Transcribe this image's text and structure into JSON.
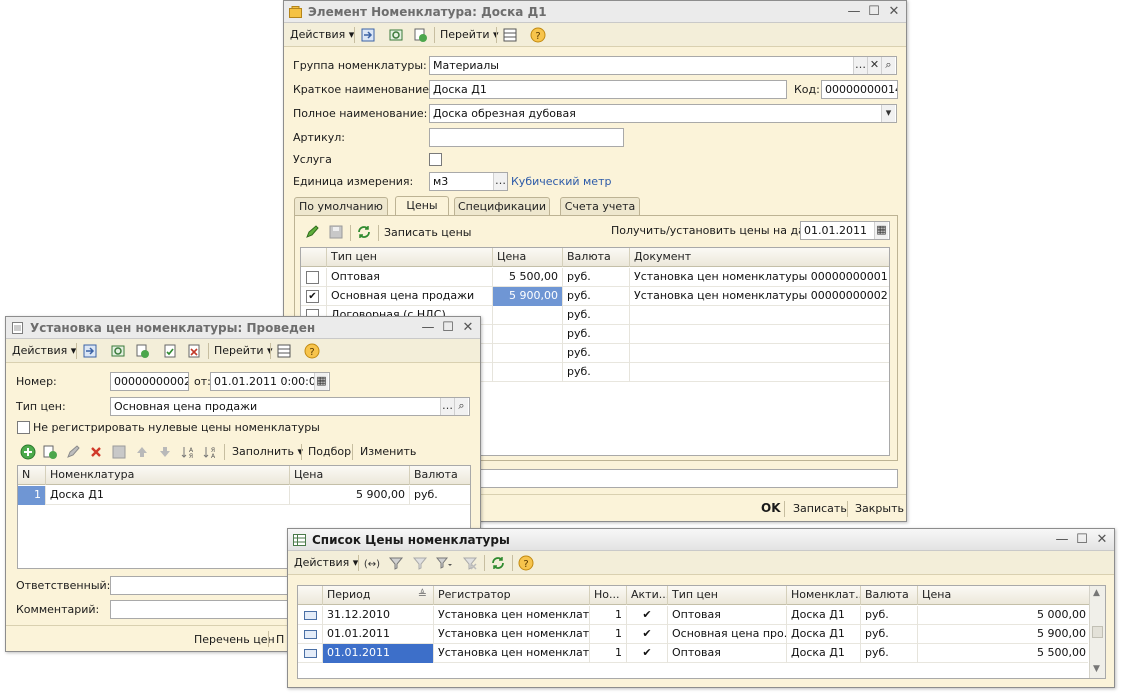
{
  "win1": {
    "title": "Элемент Номенклатура: Доска Д1",
    "toolbar": {
      "actions": "Действия ▾",
      "goto": "Перейти ▾"
    },
    "form": {
      "group_label": "Группа номенклатуры:",
      "group_value": "Материалы",
      "short_label": "Краткое наименование:",
      "short_value": "Доска Д1",
      "code_label": "Код:",
      "code_value": "00000000014",
      "full_label": "Полное наименование:",
      "full_value": "Доска обрезная дубовая",
      "article_label": "Артикул:",
      "article_value": "",
      "service_label": "Услуга",
      "unit_label": "Единица измерения:",
      "unit_value": "м3",
      "unit_link": "Кубический метр"
    },
    "tabs": [
      "По умолчанию",
      "Цены",
      "Спецификации",
      "Счета учета"
    ],
    "prices_toolbar": {
      "write": "Записать цены",
      "date_label": "Получить/установить цены на дату:",
      "date_value": "01.01.2011"
    },
    "grid": {
      "headers": [
        "Тип цен",
        "Цена",
        "Валюта",
        "Документ"
      ],
      "rows": [
        {
          "checked": false,
          "type": "Оптовая",
          "price": "5 500,00",
          "currency": "руб.",
          "doc": "Установка цен номенклатуры 00000000001 от ..."
        },
        {
          "checked": true,
          "type": "Основная цена продажи",
          "price": "5 900,00",
          "currency": "руб.",
          "doc": "Установка цен номенклатуры 00000000002 от ..."
        },
        {
          "checked": false,
          "type": "Договорная (с НДС)",
          "price": "",
          "currency": "руб.",
          "doc": ""
        },
        {
          "checked": false,
          "type": "",
          "price": "",
          "currency": "руб.",
          "doc": ""
        },
        {
          "checked": false,
          "type": "",
          "price": "",
          "currency": "руб.",
          "doc": ""
        },
        {
          "checked": false,
          "type": "",
          "price": "",
          "currency": "руб.",
          "doc": ""
        }
      ]
    },
    "footer": {
      "ok": "OK",
      "write": "Записать",
      "close": "Закрыть"
    }
  },
  "win2": {
    "title": "Установка цен номенклатуры: Проведен",
    "toolbar": {
      "actions": "Действия ▾",
      "goto": "Перейти ▾"
    },
    "form": {
      "number_label": "Номер:",
      "number_value": "00000000002",
      "from_label": "от:",
      "date_value": "01.01.2011  0:00:00",
      "price_type_label": "Тип цен:",
      "price_type_value": "Основная цена продажи",
      "zero_label": "Не регистрировать нулевые цены номенклатуры"
    },
    "table_toolbar": {
      "fill": "Заполнить ▾",
      "select": "Подбор",
      "change": "Изменить"
    },
    "grid": {
      "headers": [
        "N",
        "Номенклатура",
        "Цена",
        "Валюта"
      ],
      "rows": [
        {
          "n": "1",
          "item": "Доска Д1",
          "price": "5 900,00",
          "currency": "руб."
        }
      ]
    },
    "responsible_label": "Ответственный:",
    "comment_label": "Комментарий:",
    "footer": {
      "pricelist": "Перечень цен",
      "p": "П"
    }
  },
  "win3": {
    "title": "Список Цены номенклатуры",
    "toolbar": {
      "actions": "Действия ▾"
    },
    "grid": {
      "headers": [
        "Период",
        "Регистратор",
        "Но...",
        "Акти...",
        "Тип цен",
        "Номенклат...",
        "Валюта",
        "Цена"
      ],
      "rows": [
        {
          "period": "31.12.2010",
          "registrar": "Установка цен номенклат...",
          "no": "1",
          "active": "✔",
          "type": "Оптовая",
          "item": "Доска Д1",
          "currency": "руб.",
          "price": "5 000,00"
        },
        {
          "period": "01.01.2011",
          "registrar": "Установка цен номенклат...",
          "no": "1",
          "active": "✔",
          "type": "Основная цена про...",
          "item": "Доска Д1",
          "currency": "руб.",
          "price": "5 900,00"
        },
        {
          "period": "01.01.2011",
          "registrar": "Установка цен номенклат...",
          "no": "1",
          "active": "✔",
          "type": "Оптовая",
          "item": "Доска Д1",
          "currency": "руб.",
          "price": "5 500,00"
        }
      ]
    }
  }
}
